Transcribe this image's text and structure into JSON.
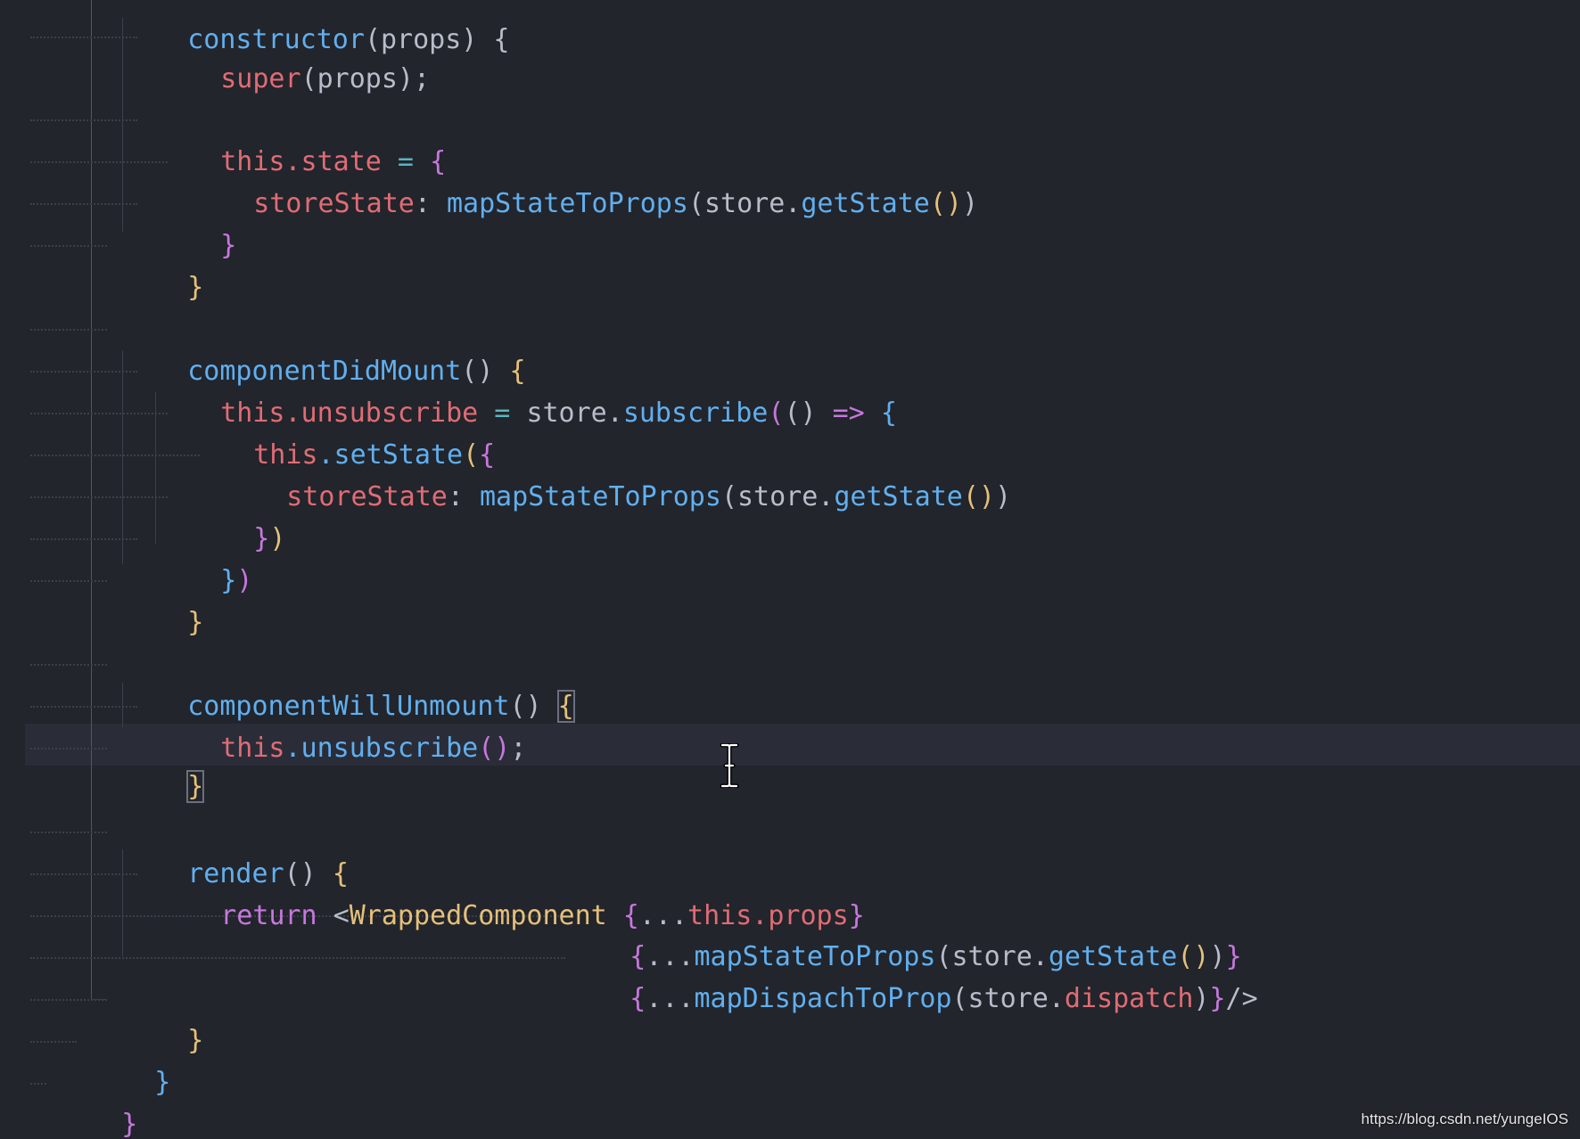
{
  "editor": {
    "language": "javascript-react",
    "theme_colors": {
      "background": "#22252b",
      "line_highlight": "#2a2d38",
      "keyword_red": "#e06c75",
      "keyword_purple": "#c678dd",
      "function_blue": "#61afef",
      "bracket_yellow": "#e5c07b",
      "plain": "#b7bdc9"
    },
    "cursor_line": 18,
    "lines": {
      "l0": [
        "constructor",
        "(props) {"
      ],
      "l1": [
        "super",
        "(props);"
      ],
      "l3": [
        "this",
        ".state",
        " = ",
        "{"
      ],
      "l4": [
        "storeState",
        ": ",
        "mapStateToProps",
        "(store.",
        "getState",
        "()",
        ")"
      ],
      "l5": [
        "}"
      ],
      "l6": [
        "}"
      ],
      "l8": [
        "componentDidMount",
        "() ",
        "{"
      ],
      "l9": [
        "this",
        ".unsubscribe",
        " = ",
        "store.",
        "subscribe",
        "(",
        "() ",
        "=> ",
        "{"
      ],
      "l10": [
        "this",
        ".setState",
        "(",
        "{"
      ],
      "l11": [
        "storeState",
        ": ",
        "mapStateToProps",
        "(store.",
        "getState",
        "()",
        ")"
      ],
      "l12": [
        "}",
        ")"
      ],
      "l13": [
        "}",
        ")"
      ],
      "l14": [
        "}"
      ],
      "l16": [
        "componentWillUnmount",
        "() ",
        "{"
      ],
      "l17": [
        "this",
        ".unsubscribe",
        "()",
        ";"
      ],
      "l18": [
        "}"
      ],
      "l20": [
        "render",
        "() ",
        "{"
      ],
      "l21": [
        "return ",
        "<",
        "WrappedComponent",
        " ",
        "{",
        "...",
        "this",
        ".props",
        "}"
      ],
      "l22": [
        "{",
        "...",
        "mapStateToProps",
        "(store.",
        "getState",
        "()",
        ")",
        "}"
      ],
      "l23": [
        "{",
        "...",
        "mapDispachToProp",
        "(store.",
        "dispatch",
        ")",
        "}",
        "/>"
      ],
      "l24": [
        "}"
      ],
      "l25": [
        "}"
      ],
      "l26": [
        "}"
      ],
      "l27": [
        "}"
      ]
    }
  },
  "watermark": "https://blog.csdn.net/yungeIOS"
}
